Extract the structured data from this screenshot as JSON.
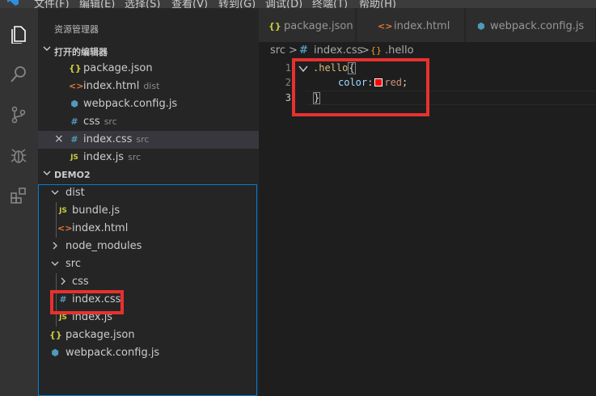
{
  "menubar": {
    "items": [
      "文件(F)",
      "编辑(E)",
      "选择(S)",
      "查看(V)",
      "转到(G)",
      "调试(D)",
      "终端(T)",
      "帮助(H)"
    ]
  },
  "activitybar": {
    "icons": [
      "files-icon",
      "search-icon",
      "source-control-icon",
      "debug-icon",
      "extensions-icon"
    ]
  },
  "sidebar": {
    "title": "资源管理器",
    "open_editors": {
      "label": "打开的编辑器",
      "items": [
        {
          "icon": "{}",
          "name": "package.json",
          "desc": ""
        },
        {
          "icon": "<>",
          "name": "index.html",
          "desc": "dist"
        },
        {
          "icon": "⬢",
          "name": "webpack.config.js",
          "desc": ""
        },
        {
          "icon": "#",
          "name": "css",
          "desc": "src"
        },
        {
          "icon": "#",
          "name": "index.css",
          "desc": "src"
        },
        {
          "icon": "JS",
          "name": "index.js",
          "desc": "src"
        }
      ]
    },
    "workspace": {
      "label": "DEMO2",
      "tree": [
        {
          "name": "dist",
          "icon": ""
        },
        {
          "name": "bundle.js",
          "icon": "JS"
        },
        {
          "name": "index.html",
          "icon": "<>"
        },
        {
          "name": "node_modules",
          "icon": ""
        },
        {
          "name": "src",
          "icon": ""
        },
        {
          "name": "css",
          "icon": ""
        },
        {
          "name": "index.css",
          "icon": "#"
        },
        {
          "name": "index.js",
          "icon": "JS"
        },
        {
          "name": "package.json",
          "icon": "{}"
        },
        {
          "name": "webpack.config.js",
          "icon": "⬢"
        }
      ]
    }
  },
  "tabs": [
    {
      "icon": "{}",
      "label": "package.json"
    },
    {
      "icon": "<>",
      "label": "index.html"
    },
    {
      "icon": "⬢",
      "label": "webpack.config.js"
    }
  ],
  "breadcrumb": {
    "folder": "src",
    "sep": ">",
    "file_icon": "#",
    "file": "index.css",
    "symbol_icon": "{}",
    "symbol": ".hello"
  },
  "editor": {
    "line_numbers": [
      "1",
      "2",
      "3"
    ],
    "line1": {
      "selector": ".hello",
      "brace": "{"
    },
    "line2": {
      "prop": "color",
      "colon": ":",
      "value": "red",
      "semi": ";"
    },
    "line3": {
      "brace": "}"
    }
  },
  "colors": {
    "highlight_box": "#e8312e",
    "swatch": "#ff0000",
    "focus_border": "#007fd4"
  }
}
